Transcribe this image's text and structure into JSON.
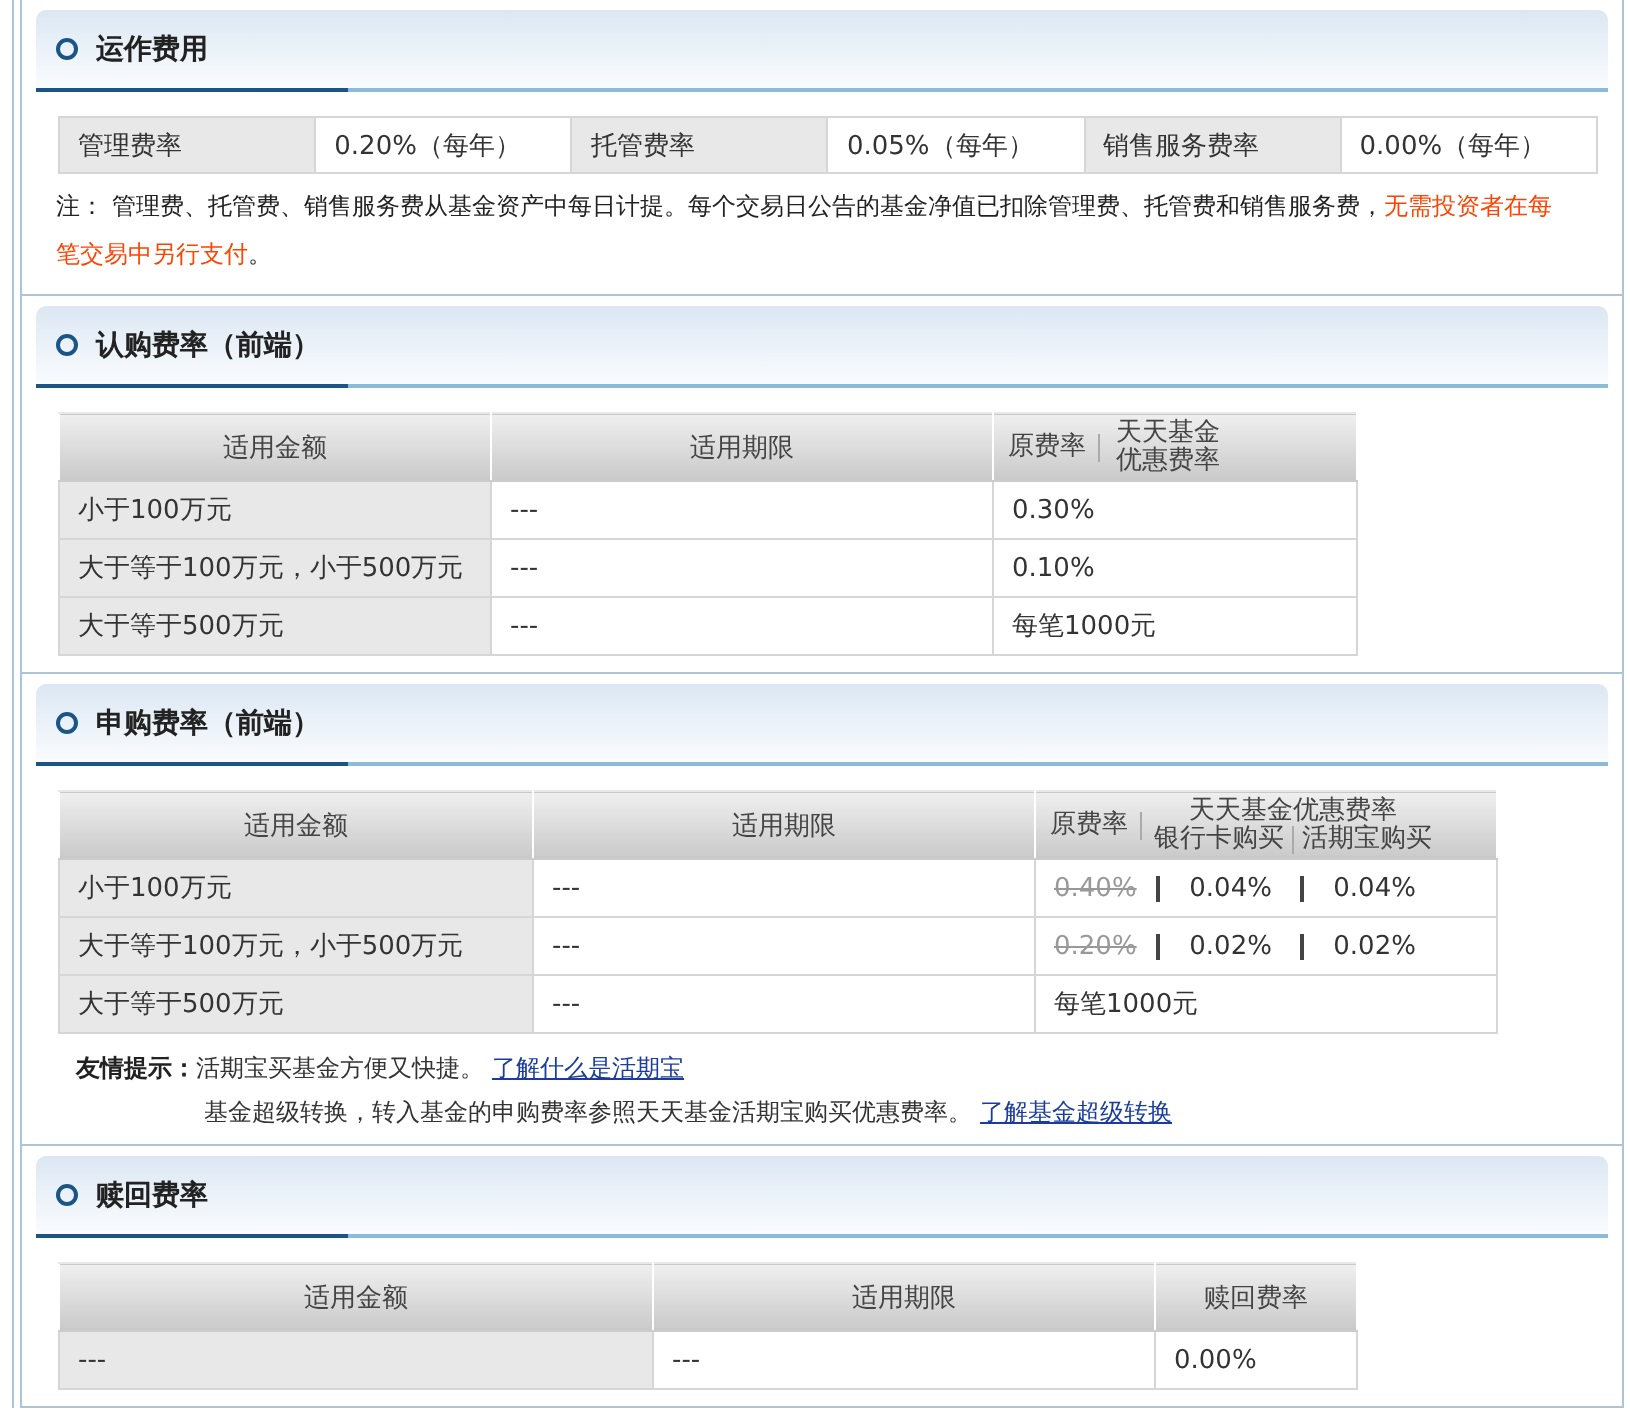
{
  "sections": [
    {
      "kind": "grid",
      "title": "运作费用",
      "cells": [
        {
          "label": "管理费率",
          "value": "0.20%（每年）"
        },
        {
          "label": "托管费率",
          "value": "0.05%（每年）"
        },
        {
          "label": "销售服务费率",
          "value": "0.00%（每年）"
        }
      ],
      "note": {
        "text": "注：  管理费、托管费、销售服务费从基金资产中每日计提。每个交易日公告的基金净值已扣除管理费、托管费和销售服务费，",
        "emphasis": "无需投资者在每笔交易中另行支付",
        "end": "。"
      }
    },
    {
      "kind": "table",
      "title": "认购费率（前端）",
      "columns": [
        {
          "label": "适用金额"
        },
        {
          "label": "适用期限"
        },
        {
          "label": "原费率",
          "discount": "天天基金优惠费率"
        }
      ],
      "rows": [
        {
          "amount": "小于100万元",
          "period": "---",
          "kind": "flat",
          "rate": "0.30%"
        },
        {
          "amount": "大于等于100万元，小于500万元",
          "period": "---",
          "kind": "flat",
          "rate": "0.10%"
        },
        {
          "amount": "大于等于500万元",
          "period": "---",
          "kind": "flat",
          "rate": "每笔1000元"
        }
      ]
    },
    {
      "kind": "table",
      "title": "申购费率（前端）",
      "columns": [
        {
          "label": "适用金额"
        },
        {
          "label": "适用期限"
        },
        {
          "label": "原费率",
          "discount": "天天基金优惠费率",
          "sub": [
            "银行卡购买",
            "活期宝购买"
          ]
        }
      ],
      "rows": [
        {
          "amount": "小于100万元",
          "period": "---",
          "kind": "discounted",
          "original": "0.40%",
          "rates": [
            "0.04%",
            "0.04%"
          ]
        },
        {
          "amount": "大于等于100万元，小于500万元",
          "period": "---",
          "kind": "discounted",
          "original": "0.20%",
          "rates": [
            "0.02%",
            "0.02%"
          ]
        },
        {
          "amount": "大于等于500万元",
          "period": "---",
          "kind": "flat",
          "rate": "每笔1000元"
        }
      ],
      "tips": {
        "label": "友情提示：",
        "lines": [
          {
            "text": "活期宝买基金方便又快捷。",
            "link": "了解什么是活期宝"
          },
          {
            "text": "基金超级转换，转入基金的申购费率参照天天基金活期宝购买优惠费率。",
            "link": "了解基金超级转换"
          }
        ]
      }
    },
    {
      "kind": "table",
      "title": "赎回费率",
      "columns": [
        {
          "label": "适用金额"
        },
        {
          "label": "适用期限"
        },
        {
          "label": "赎回费率"
        }
      ],
      "rows": [
        {
          "amount": "---",
          "period": "---",
          "kind": "flat",
          "rate": "0.00%"
        }
      ]
    }
  ]
}
